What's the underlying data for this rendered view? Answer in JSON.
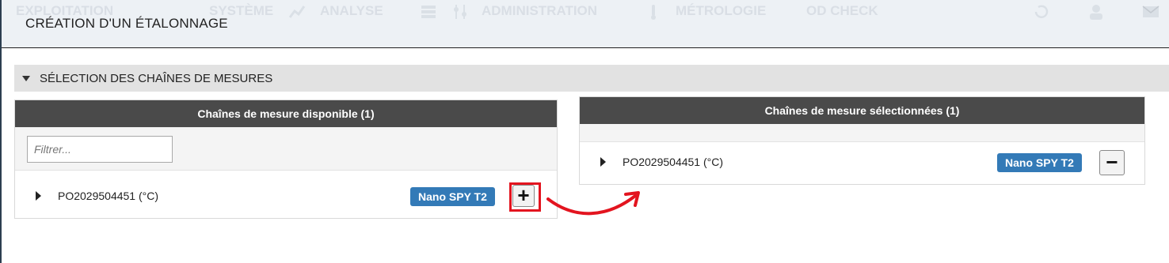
{
  "topnav": {
    "items": [
      "EXPLOITATION",
      "SYSTÈME",
      "ANALYSE",
      "ADMINISTRATION",
      "MÉTROLOGIE",
      "OD CHECK"
    ]
  },
  "dialog": {
    "title": "CRÉATION D'UN ÉTALONNAGE"
  },
  "section": {
    "title": "SÉLECTION DES CHAÎNES DE MESURES"
  },
  "available": {
    "header": "Chaînes de mesure disponible (1)",
    "filter_placeholder": "Filtrer...",
    "filter_value": "",
    "items": [
      {
        "label": "PO2029504451 (°C)",
        "badge": "Nano SPY T2",
        "action": "+"
      }
    ]
  },
  "selected": {
    "header": "Chaînes de mesure sélectionnées (1)",
    "items": [
      {
        "label": "PO2029504451 (°C)",
        "badge": "Nano SPY T2",
        "action": "−"
      }
    ]
  },
  "colors": {
    "panel_header": "#4a4a4a",
    "badge": "#337ab7",
    "highlight": "#e3141f"
  }
}
